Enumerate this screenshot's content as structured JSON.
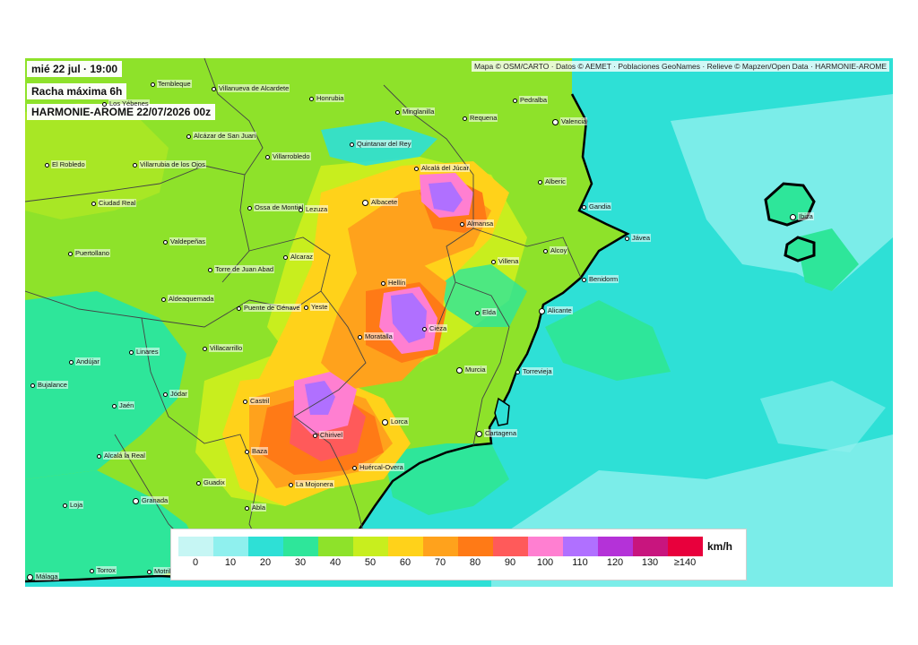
{
  "header": {
    "datetime": "mié 22 jul · 19:00",
    "variable": "Racha máxima 6h",
    "model_run": "HARMONIE-AROME 22/07/2026 00z"
  },
  "attribution": "Mapa © OSM/CARTO · Datos © AEMET · Poblaciones GeoNames · Relieve © Mapzen/Open Data · HARMONIE-AROME",
  "legend": {
    "unit": "km/h",
    "ticks": [
      "0",
      "10",
      "20",
      "30",
      "40",
      "50",
      "60",
      "70",
      "80",
      "90",
      "100",
      "110",
      "120",
      "130",
      "≥140"
    ],
    "colors": [
      "#c6f6f4",
      "#8ff0ee",
      "#2ee0d6",
      "#2ee69a",
      "#8ee22a",
      "#c8ee1e",
      "#ffd21a",
      "#ffa21c",
      "#ff7a16",
      "#ff5a5a",
      "#ff7fd1",
      "#b070ff",
      "#b432d8",
      "#c8157e",
      "#e8003c"
    ]
  },
  "cities": [
    {
      "name": "Tembleque"
    },
    {
      "name": "Villanueva de Alcardete"
    },
    {
      "name": "Honrubia"
    },
    {
      "name": "Los Yébenes"
    },
    {
      "name": "Minglanilla"
    },
    {
      "name": "Requena"
    },
    {
      "name": "Pedralba"
    },
    {
      "name": "Valencia"
    },
    {
      "name": "Alcázar de San Juan"
    },
    {
      "name": "Quintanar del Rey"
    },
    {
      "name": "El Robledo"
    },
    {
      "name": "Villarrubia de los Ojos"
    },
    {
      "name": "Villarrobledo"
    },
    {
      "name": "Alcalá del Júcar"
    },
    {
      "name": "Alberic"
    },
    {
      "name": "Ciudad Real"
    },
    {
      "name": "Albacete"
    },
    {
      "name": "Ossa de Montiel"
    },
    {
      "name": "Lezuza"
    },
    {
      "name": "Gandia"
    },
    {
      "name": "Ibiza"
    },
    {
      "name": "Almansa"
    },
    {
      "name": "Valdepeñas"
    },
    {
      "name": "Jávea"
    },
    {
      "name": "Alcoy"
    },
    {
      "name": "Puertollano"
    },
    {
      "name": "Alcaraz"
    },
    {
      "name": "Villena"
    },
    {
      "name": "Torre de Juan Abad"
    },
    {
      "name": "Benidorm"
    },
    {
      "name": "Hellín"
    },
    {
      "name": "Aldeaquemada"
    },
    {
      "name": "Puente de Génave"
    },
    {
      "name": "Yeste"
    },
    {
      "name": "Alicante"
    },
    {
      "name": "Elda"
    },
    {
      "name": "Cieza"
    },
    {
      "name": "Moratalla"
    },
    {
      "name": "Villacarrillo"
    },
    {
      "name": "Linares"
    },
    {
      "name": "Andújar"
    },
    {
      "name": "Torrevieja"
    },
    {
      "name": "Murcia"
    },
    {
      "name": "Bujalance"
    },
    {
      "name": "Jódar"
    },
    {
      "name": "Castril"
    },
    {
      "name": "Jaén"
    },
    {
      "name": "Lorca"
    },
    {
      "name": "Cartagena"
    },
    {
      "name": "Chirivel"
    },
    {
      "name": "Baza"
    },
    {
      "name": "Alcalá la Real"
    },
    {
      "name": "Huércal-Overa"
    },
    {
      "name": "Guadix"
    },
    {
      "name": "La Mojonera"
    },
    {
      "name": "Granada"
    },
    {
      "name": "Loja"
    },
    {
      "name": "Abla"
    },
    {
      "name": "Málaga"
    },
    {
      "name": "Torrox"
    },
    {
      "name": "Motril"
    }
  ]
}
